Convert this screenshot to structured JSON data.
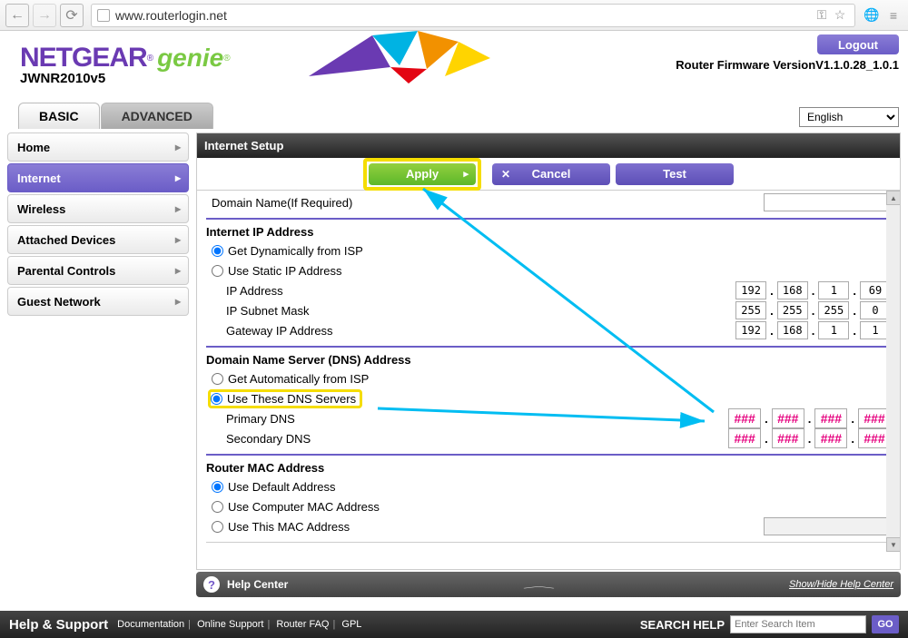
{
  "browser": {
    "url": "www.routerlogin.net"
  },
  "brand": {
    "netgear": "NETGEAR",
    "genie": "genie",
    "reg": "®",
    "model": "JWNR2010v5"
  },
  "header": {
    "logout": "Logout",
    "firmware_label": "Router Firmware Version",
    "firmware_version": "V1.1.0.28_1.0.1"
  },
  "tabs": {
    "basic": "BASIC",
    "advanced": "ADVANCED"
  },
  "language": "English",
  "sidebar": [
    {
      "k": "home",
      "label": "Home"
    },
    {
      "k": "internet",
      "label": "Internet"
    },
    {
      "k": "wireless",
      "label": "Wireless"
    },
    {
      "k": "attached",
      "label": "Attached Devices"
    },
    {
      "k": "parental",
      "label": "Parental Controls"
    },
    {
      "k": "guest",
      "label": "Guest Network"
    }
  ],
  "page": {
    "title": "Internet Setup"
  },
  "buttons": {
    "apply": "Apply",
    "cancel": "Cancel",
    "test": "Test"
  },
  "form": {
    "domain_name": "Domain Name(If Required)",
    "ip_header": "Internet IP Address",
    "ip_dyn": "Get Dynamically from ISP",
    "ip_static": "Use Static IP Address",
    "ip_addr_label": "IP Address",
    "ip_mask_label": "IP Subnet Mask",
    "ip_gw_label": "Gateway IP Address",
    "ip_addr": [
      "192",
      "168",
      "1",
      "69"
    ],
    "ip_mask": [
      "255",
      "255",
      "255",
      "0"
    ],
    "ip_gw": [
      "192",
      "168",
      "1",
      "1"
    ],
    "dns_header": "Domain Name Server (DNS) Address",
    "dns_auto": "Get Automatically from ISP",
    "dns_manual": "Use These DNS Servers",
    "dns_primary_label": "Primary DNS",
    "dns_secondary_label": "Secondary DNS",
    "dns_placeholder": "###",
    "mac_header": "Router MAC Address",
    "mac_default": "Use Default Address",
    "mac_computer": "Use Computer MAC Address",
    "mac_this": "Use This MAC Address"
  },
  "help_center": {
    "title": "Help Center",
    "toggle": "Show/Hide Help Center"
  },
  "footer": {
    "hs": "Help & Support",
    "links": [
      "Documentation",
      "Online Support",
      "Router FAQ",
      "GPL"
    ],
    "search_label": "SEARCH HELP",
    "search_placeholder": "Enter Search Item",
    "go": "GO"
  }
}
